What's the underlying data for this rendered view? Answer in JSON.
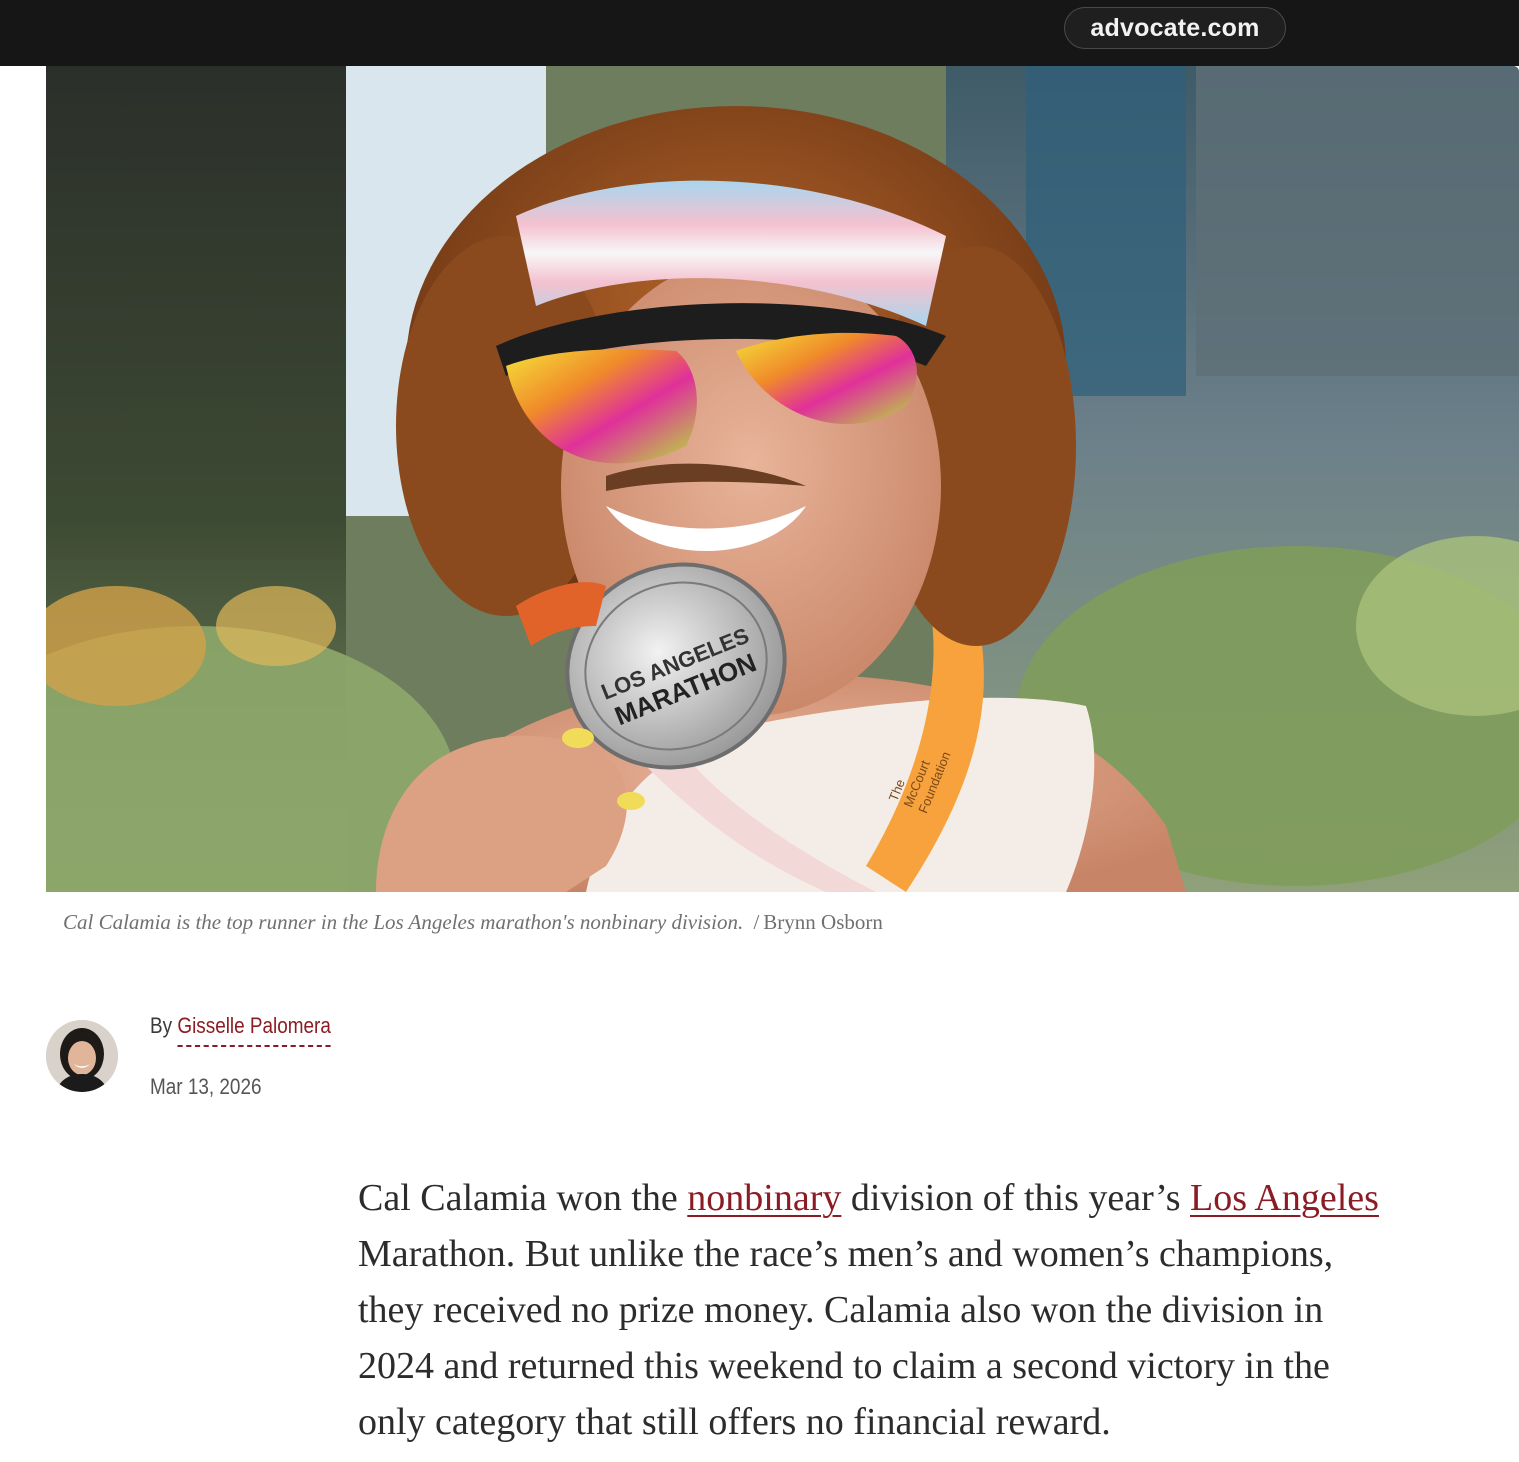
{
  "browser": {
    "url_host": "advocate.com"
  },
  "hero": {
    "medal_text": [
      "LOS ANGELES",
      "MARATHON"
    ],
    "lanyard_text": [
      "The",
      "McCourt",
      "Foundation"
    ]
  },
  "caption": {
    "text": "Cal Calamia is the top runner in the Los Angeles marathon's nonbinary division.",
    "separator": "/",
    "credit": "Brynn Osborn"
  },
  "byline": {
    "prefix": "By",
    "author": "Gisselle Palomera",
    "date": "Mar 13, 2026"
  },
  "article": {
    "p1_s1": "Cal Calamia won the ",
    "p1_link1": "nonbinary",
    "p1_s2": " division of this year’s ",
    "p1_link2": "Los Angeles",
    "p1_line2": "Marathon. But unlike the race’s men’s and women’s champions,",
    "p1_line3": "they received no prize money. Calamia also won the division in",
    "p1_line4": "2024 and returned this weekend to claim a second victory in the",
    "p1_line5": "only category that still offers no financial reward."
  },
  "colors": {
    "topbar": "#161616",
    "link": "#8b1c24",
    "caption": "#707070",
    "body_text": "#2c2c2c"
  }
}
